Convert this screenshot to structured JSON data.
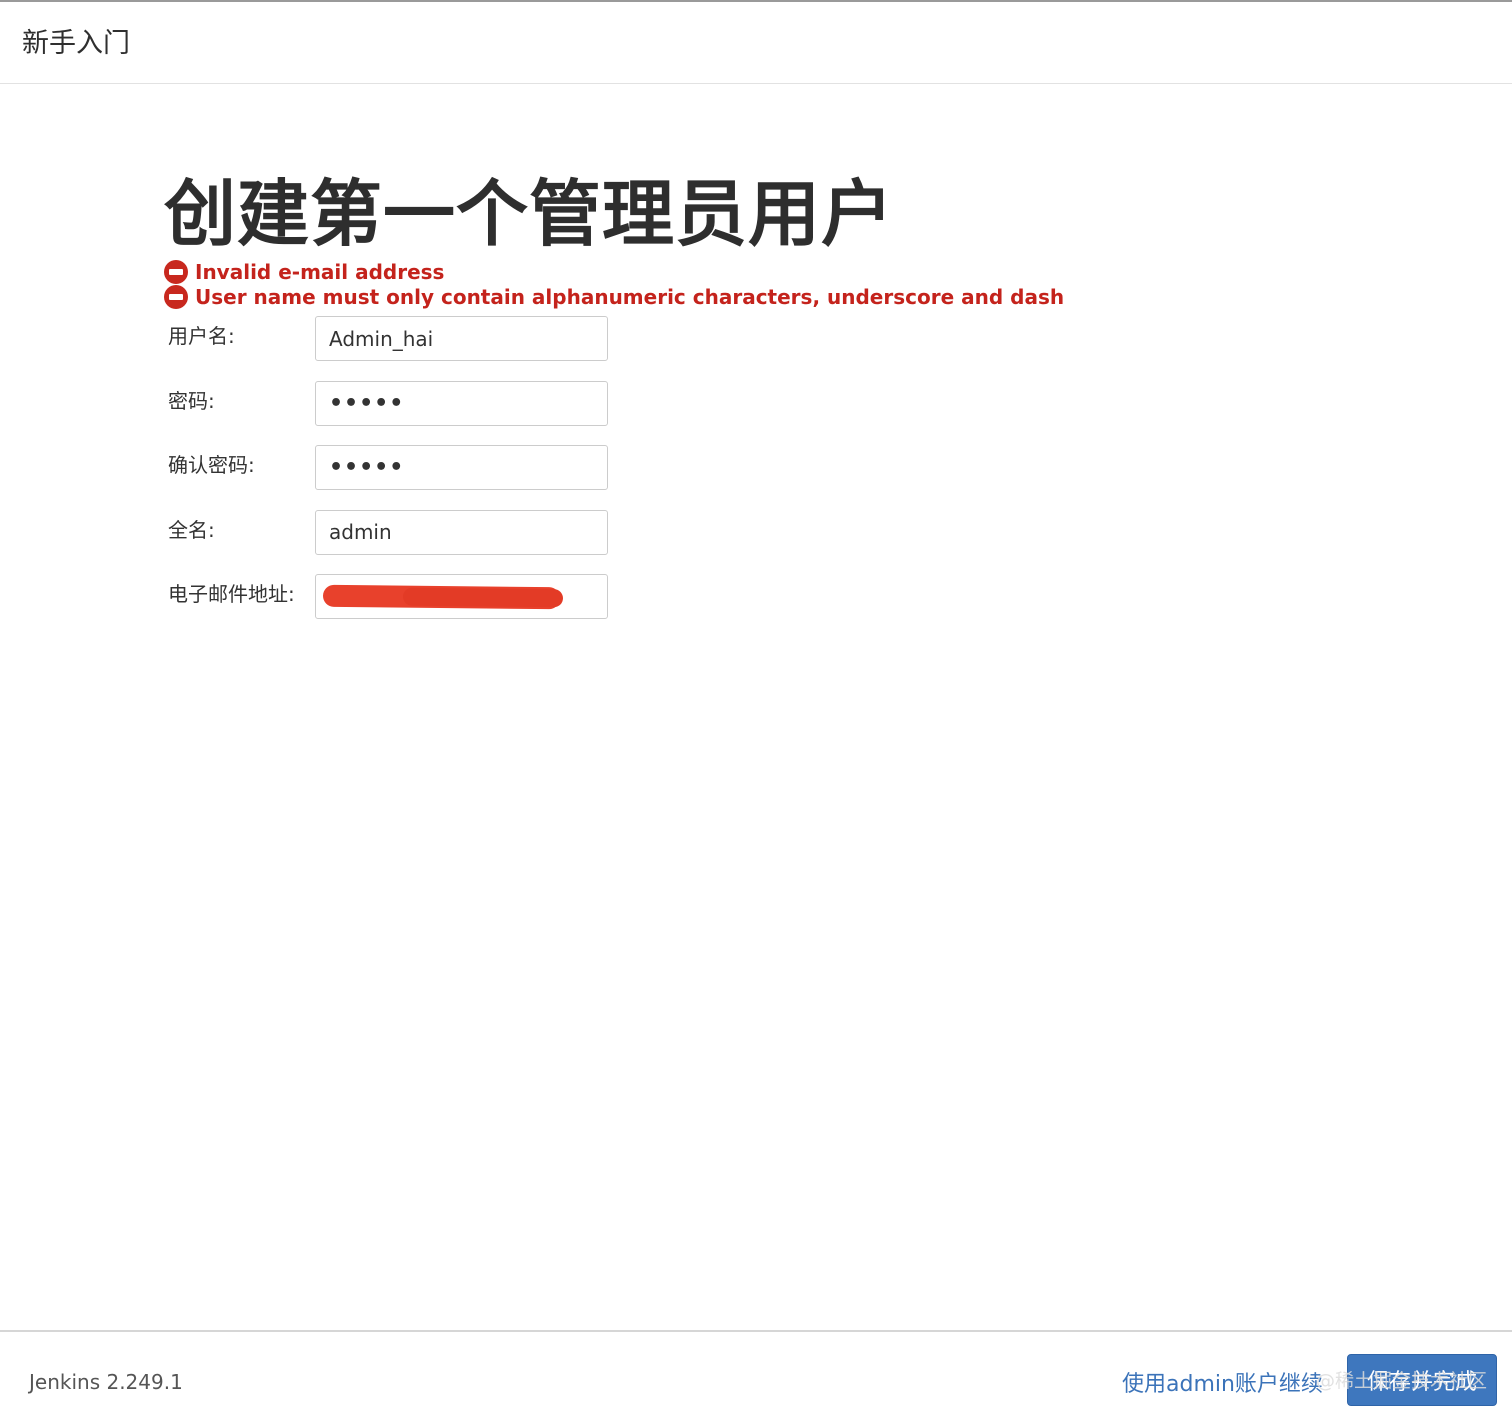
{
  "header": {
    "title": "新手入门"
  },
  "page": {
    "heading": "创建第一个管理员用户"
  },
  "errors": [
    "Invalid e-mail address",
    "User name must only contain alphanumeric characters, underscore and dash"
  ],
  "form": {
    "fields": [
      {
        "label": "用户名:",
        "value": "Admin_hai"
      },
      {
        "label": "密码:",
        "value": "•••••"
      },
      {
        "label": "确认密码:",
        "value": "•••••"
      },
      {
        "label": "全名:",
        "value": "admin"
      },
      {
        "label": "电子邮件地址:",
        "value": ""
      }
    ]
  },
  "footer": {
    "version": "Jenkins 2.249.1",
    "continue_link": "使用admin账户继续",
    "save_button": "保存并完成",
    "watermark": "@稀土掘金技术社区"
  },
  "colors": {
    "error": "#c4231c",
    "link": "#3b73b9",
    "primary_button": "#3e77be",
    "redaction": "#e8412c"
  },
  "icons": [
    "error-icon",
    "error-icon"
  ]
}
